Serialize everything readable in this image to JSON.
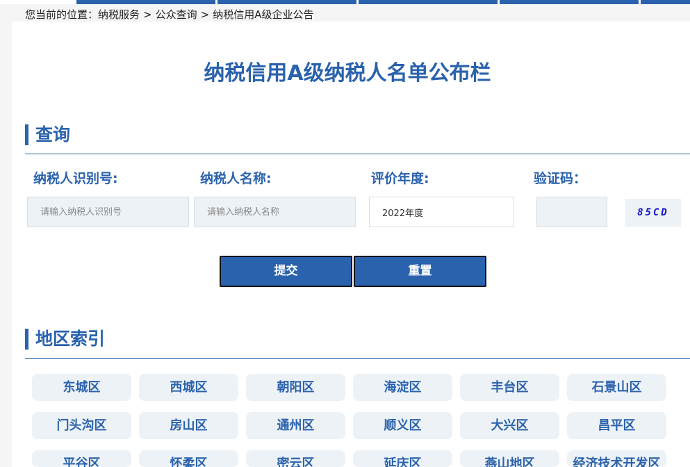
{
  "breadcrumb": {
    "prefix": "您当前的位置：",
    "items": [
      "纳税服务",
      "公众查询",
      "纳税信用A级企业公告"
    ],
    "separator": ">"
  },
  "page_title": "纳税信用A级纳税人名单公布栏",
  "query_section": {
    "title": "查询",
    "fields": {
      "taxpayer_id_label": "纳税人识别号:",
      "taxpayer_id_placeholder": "请输入纳税人识别号",
      "taxpayer_name_label": "纳税人名称:",
      "taxpayer_name_placeholder": "请输入纳税人名称",
      "year_label": "评价年度:",
      "year_value": "2022年度",
      "captcha_label": "验证码：",
      "captcha_value": "",
      "captcha_text": "85CD"
    },
    "buttons": {
      "submit": "提交",
      "reset": "重置"
    }
  },
  "region_section": {
    "title": "地区索引",
    "regions": [
      "东城区",
      "西城区",
      "朝阳区",
      "海淀区",
      "丰台区",
      "石景山区",
      "门头沟区",
      "房山区",
      "通州区",
      "顺义区",
      "大兴区",
      "昌平区",
      "平谷区",
      "怀柔区",
      "密云区",
      "延庆区",
      "燕山地区",
      "经济技术开发区"
    ]
  },
  "colors": {
    "accent": "#2a62ad",
    "field_bg": "#edf2f6",
    "captcha_text": "#1010cc"
  }
}
